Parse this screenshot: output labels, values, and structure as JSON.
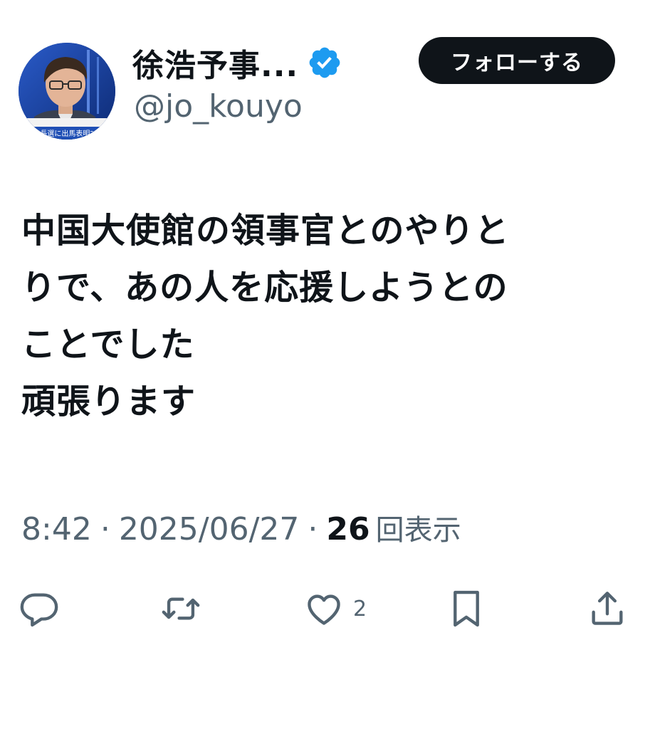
{
  "user": {
    "display_name": "徐浩予事...",
    "handle": "@jo_kouyo",
    "verified": true,
    "avatar_icon": "profile-photo",
    "avatar_caption": "長選に出馬表明?"
  },
  "follow_button": {
    "label": "フォローする"
  },
  "tweet": {
    "lines": [
      "中国大使館の領事官とのやりと",
      "りで、あの人を応援しようとの",
      "ことでした",
      "頑張ります"
    ]
  },
  "meta": {
    "time": "8:42",
    "separator": "·",
    "date": "2025/06/27",
    "views_count": "26",
    "views_label": "回表示"
  },
  "actions": {
    "reply_icon": "reply-icon",
    "retweet_icon": "retweet-icon",
    "like_icon": "heart-icon",
    "like_count": "2",
    "bookmark_icon": "bookmark-icon",
    "share_icon": "share-icon"
  },
  "colors": {
    "text": "#0f1419",
    "secondary": "#536471",
    "verified": "#1d9bf0",
    "button_bg": "#0f1419"
  }
}
